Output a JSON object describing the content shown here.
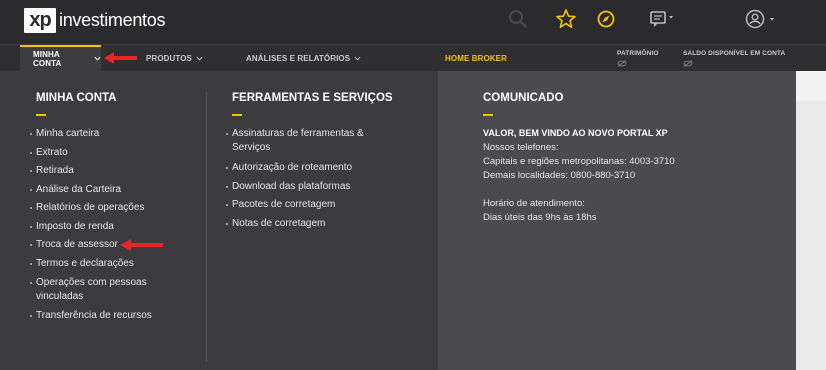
{
  "brand": {
    "logo_mark": "xp",
    "logo_text": "investimentos"
  },
  "topbar": {
    "icons": [
      "search-icon",
      "star-icon",
      "compass-icon",
      "chat-icon",
      "user-icon"
    ]
  },
  "nav": {
    "items": [
      {
        "label": "MINHA CONTA"
      },
      {
        "label": "PRODUTOS"
      },
      {
        "label": "ANÁLISES E RELATÓRIOS"
      },
      {
        "label": "HOME BROKER"
      }
    ],
    "patrimonio": "PATRIMÔNIO",
    "saldo": "SALDO DISPONÍVEL EM CONTA"
  },
  "menu": {
    "minha_conta": {
      "title": "MINHA CONTA",
      "links": [
        "Minha carteira",
        "Extrato",
        "Retirada",
        "Análise da Carteira",
        "Relatórios de operações",
        "Imposto de renda",
        "Troca de assessor",
        "Termos e declarações",
        "Operações com pessoas",
        "vinculadas",
        "Transferência de recursos"
      ]
    },
    "ferramentas": {
      "title": "FERRAMENTAS E SERVIÇOS",
      "links": [
        "Assinaturas de ferramentas &",
        "Serviços",
        "Autorização de roteamento",
        "Download das plataformas",
        "Pacotes de corretagem",
        "Notas de corretagem"
      ]
    },
    "comunicado": {
      "title": "COMUNICADO",
      "headline": "VALOR, BEM VINDO AO NOVO PORTAL XP",
      "lines": [
        "Nossos telefones:",
        "Capitais e regiões metropolitanas: 4003-3710",
        "Demais localidades: 0800-880-3710",
        "Horário de atendimento:",
        "Dias úteis das 9hs às 18hs"
      ]
    }
  },
  "colors": {
    "accent": "#f5c400",
    "annotation": "#e8232a"
  }
}
